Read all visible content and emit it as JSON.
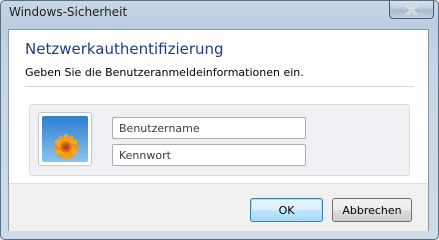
{
  "window": {
    "title": "Windows-Sicherheit",
    "close_icon": "close-icon"
  },
  "dialog": {
    "heading": "Netzwerkauthentifizierung",
    "description": "Geben Sie die Benutzeranmeldeinformationen ein."
  },
  "credentials": {
    "avatar_icon": "user-tile-flower-icon",
    "username": {
      "value": "",
      "placeholder": "Benutzername"
    },
    "password": {
      "value": "",
      "placeholder": "Kennwort"
    }
  },
  "buttons": {
    "ok_label": "OK",
    "cancel_label": "Abbrechen"
  },
  "colors": {
    "heading": "#1d3f82",
    "frame": "#bccde0",
    "default_button_border": "#3c7fb1"
  }
}
